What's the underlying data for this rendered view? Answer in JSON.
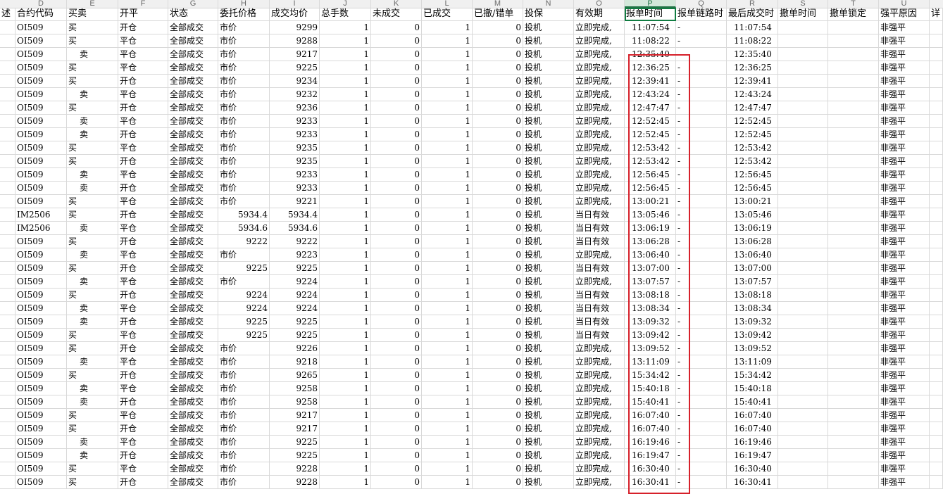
{
  "column_letters": [
    "D",
    "E",
    "F",
    "G",
    "H",
    "I",
    "J",
    "K",
    "L",
    "M",
    "N",
    "O",
    "P",
    "Q",
    "R",
    "S",
    "T",
    "U"
  ],
  "selected_column": "P",
  "header": {
    "a": "述",
    "d": "合约代码",
    "e": "买卖",
    "f": "开平",
    "g": "状态",
    "h": "委托价格",
    "i": "成交均价",
    "j": "总手数",
    "k": "未成交",
    "l": "已成交",
    "m": "已撤/错单",
    "n": "投保",
    "o": "有效期",
    "p": "报单时间",
    "q": "报单链路时",
    "r": "最后成交时",
    "s": "撤单时间",
    "t": "撤单锁定",
    "u": "强平原因",
    "v": "详"
  },
  "rows": [
    {
      "d": "OI509",
      "e": "买",
      "f": "开仓",
      "g": "全部成交",
      "h": "市价",
      "i": "9299",
      "j": "1",
      "k": "0",
      "l": "1",
      "m": "0",
      "n": "投机",
      "o": "立即完成,",
      "p": "11:07:54",
      "q": "-",
      "r": "11:07:54",
      "u": "非强平"
    },
    {
      "d": "OI509",
      "e": "买",
      "f": "平仓",
      "g": "全部成交",
      "h": "市价",
      "i": "9288",
      "j": "1",
      "k": "0",
      "l": "1",
      "m": "0",
      "n": "投机",
      "o": "立即完成,",
      "p": "11:08:22",
      "q": "-",
      "r": "11:08:22",
      "u": "非强平"
    },
    {
      "d": "OI509",
      "e": "卖",
      "f": "平仓",
      "g": "全部成交",
      "h": "市价",
      "i": "9217",
      "j": "1",
      "k": "0",
      "l": "1",
      "m": "0",
      "n": "投机",
      "o": "立即完成,",
      "p": "12:35:40",
      "q": "-",
      "r": "12:35:40",
      "u": "非强平"
    },
    {
      "d": "OI509",
      "e": "买",
      "f": "平仓",
      "g": "全部成交",
      "h": "市价",
      "i": "9225",
      "j": "1",
      "k": "0",
      "l": "1",
      "m": "0",
      "n": "投机",
      "o": "立即完成,",
      "p": "12:36:25",
      "q": "-",
      "r": "12:36:25",
      "u": "非强平"
    },
    {
      "d": "OI509",
      "e": "买",
      "f": "开仓",
      "g": "全部成交",
      "h": "市价",
      "i": "9234",
      "j": "1",
      "k": "0",
      "l": "1",
      "m": "0",
      "n": "投机",
      "o": "立即完成,",
      "p": "12:39:41",
      "q": "-",
      "r": "12:39:41",
      "u": "非强平"
    },
    {
      "d": "OI509",
      "e": "卖",
      "f": "平仓",
      "g": "全部成交",
      "h": "市价",
      "i": "9232",
      "j": "1",
      "k": "0",
      "l": "1",
      "m": "0",
      "n": "投机",
      "o": "立即完成,",
      "p": "12:43:24",
      "q": "-",
      "r": "12:43:24",
      "u": "非强平"
    },
    {
      "d": "OI509",
      "e": "买",
      "f": "开仓",
      "g": "全部成交",
      "h": "市价",
      "i": "9236",
      "j": "1",
      "k": "0",
      "l": "1",
      "m": "0",
      "n": "投机",
      "o": "立即完成,",
      "p": "12:47:47",
      "q": "-",
      "r": "12:47:47",
      "u": "非强平"
    },
    {
      "d": "OI509",
      "e": "卖",
      "f": "平仓",
      "g": "全部成交",
      "h": "市价",
      "i": "9233",
      "j": "1",
      "k": "0",
      "l": "1",
      "m": "0",
      "n": "投机",
      "o": "立即完成,",
      "p": "12:52:45",
      "q": "-",
      "r": "12:52:45",
      "u": "非强平"
    },
    {
      "d": "OI509",
      "e": "卖",
      "f": "开仓",
      "g": "全部成交",
      "h": "市价",
      "i": "9233",
      "j": "1",
      "k": "0",
      "l": "1",
      "m": "0",
      "n": "投机",
      "o": "立即完成,",
      "p": "12:52:45",
      "q": "-",
      "r": "12:52:45",
      "u": "非强平"
    },
    {
      "d": "OI509",
      "e": "买",
      "f": "平仓",
      "g": "全部成交",
      "h": "市价",
      "i": "9235",
      "j": "1",
      "k": "0",
      "l": "1",
      "m": "0",
      "n": "投机",
      "o": "立即完成,",
      "p": "12:53:42",
      "q": "-",
      "r": "12:53:42",
      "u": "非强平"
    },
    {
      "d": "OI509",
      "e": "买",
      "f": "开仓",
      "g": "全部成交",
      "h": "市价",
      "i": "9235",
      "j": "1",
      "k": "0",
      "l": "1",
      "m": "0",
      "n": "投机",
      "o": "立即完成,",
      "p": "12:53:42",
      "q": "-",
      "r": "12:53:42",
      "u": "非强平"
    },
    {
      "d": "OI509",
      "e": "卖",
      "f": "平仓",
      "g": "全部成交",
      "h": "市价",
      "i": "9233",
      "j": "1",
      "k": "0",
      "l": "1",
      "m": "0",
      "n": "投机",
      "o": "立即完成,",
      "p": "12:56:45",
      "q": "-",
      "r": "12:56:45",
      "u": "非强平"
    },
    {
      "d": "OI509",
      "e": "卖",
      "f": "开仓",
      "g": "全部成交",
      "h": "市价",
      "i": "9233",
      "j": "1",
      "k": "0",
      "l": "1",
      "m": "0",
      "n": "投机",
      "o": "立即完成,",
      "p": "12:56:45",
      "q": "-",
      "r": "12:56:45",
      "u": "非强平"
    },
    {
      "d": "OI509",
      "e": "买",
      "f": "平仓",
      "g": "全部成交",
      "h": "市价",
      "i": "9221",
      "j": "1",
      "k": "0",
      "l": "1",
      "m": "0",
      "n": "投机",
      "o": "立即完成,",
      "p": "13:00:21",
      "q": "-",
      "r": "13:00:21",
      "u": "非强平"
    },
    {
      "d": "IM2506",
      "e": "买",
      "f": "开仓",
      "g": "全部成交",
      "h": "5934.4",
      "i": "5934.4",
      "j": "1",
      "k": "0",
      "l": "1",
      "m": "0",
      "n": "投机",
      "o": "当日有效",
      "p": "13:05:46",
      "q": "-",
      "r": "13:05:46",
      "u": "非强平"
    },
    {
      "d": "IM2506",
      "e": "卖",
      "f": "平仓",
      "g": "全部成交",
      "h": "5934.6",
      "i": "5934.6",
      "j": "1",
      "k": "0",
      "l": "1",
      "m": "0",
      "n": "投机",
      "o": "当日有效",
      "p": "13:06:19",
      "q": "-",
      "r": "13:06:19",
      "u": "非强平"
    },
    {
      "d": "OI509",
      "e": "买",
      "f": "开仓",
      "g": "全部成交",
      "h": "9222",
      "i": "9222",
      "j": "1",
      "k": "0",
      "l": "1",
      "m": "0",
      "n": "投机",
      "o": "当日有效",
      "p": "13:06:28",
      "q": "-",
      "r": "13:06:28",
      "u": "非强平"
    },
    {
      "d": "OI509",
      "e": "卖",
      "f": "平仓",
      "g": "全部成交",
      "h": "市价",
      "i": "9223",
      "j": "1",
      "k": "0",
      "l": "1",
      "m": "0",
      "n": "投机",
      "o": "立即完成,",
      "p": "13:06:40",
      "q": "-",
      "r": "13:06:40",
      "u": "非强平"
    },
    {
      "d": "OI509",
      "e": "买",
      "f": "开仓",
      "g": "全部成交",
      "h": "9225",
      "i": "9225",
      "j": "1",
      "k": "0",
      "l": "1",
      "m": "0",
      "n": "投机",
      "o": "当日有效",
      "p": "13:07:00",
      "q": "-",
      "r": "13:07:00",
      "u": "非强平"
    },
    {
      "d": "OI509",
      "e": "卖",
      "f": "平仓",
      "g": "全部成交",
      "h": "市价",
      "i": "9224",
      "j": "1",
      "k": "0",
      "l": "1",
      "m": "0",
      "n": "投机",
      "o": "立即完成,",
      "p": "13:07:57",
      "q": "-",
      "r": "13:07:57",
      "u": "非强平"
    },
    {
      "d": "OI509",
      "e": "买",
      "f": "开仓",
      "g": "全部成交",
      "h": "9224",
      "i": "9224",
      "j": "1",
      "k": "0",
      "l": "1",
      "m": "0",
      "n": "投机",
      "o": "当日有效",
      "p": "13:08:18",
      "q": "-",
      "r": "13:08:18",
      "u": "非强平"
    },
    {
      "d": "OI509",
      "e": "卖",
      "f": "平仓",
      "g": "全部成交",
      "h": "9224",
      "i": "9224",
      "j": "1",
      "k": "0",
      "l": "1",
      "m": "0",
      "n": "投机",
      "o": "当日有效",
      "p": "13:08:34",
      "q": "-",
      "r": "13:08:34",
      "u": "非强平"
    },
    {
      "d": "OI509",
      "e": "卖",
      "f": "开仓",
      "g": "全部成交",
      "h": "9225",
      "i": "9225",
      "j": "1",
      "k": "0",
      "l": "1",
      "m": "0",
      "n": "投机",
      "o": "当日有效",
      "p": "13:09:32",
      "q": "-",
      "r": "13:09:32",
      "u": "非强平"
    },
    {
      "d": "OI509",
      "e": "买",
      "f": "平仓",
      "g": "全部成交",
      "h": "9225",
      "i": "9225",
      "j": "1",
      "k": "0",
      "l": "1",
      "m": "0",
      "n": "投机",
      "o": "当日有效",
      "p": "13:09:42",
      "q": "-",
      "r": "13:09:42",
      "u": "非强平"
    },
    {
      "d": "OI509",
      "e": "买",
      "f": "开仓",
      "g": "全部成交",
      "h": "市价",
      "i": "9226",
      "j": "1",
      "k": "0",
      "l": "1",
      "m": "0",
      "n": "投机",
      "o": "立即完成,",
      "p": "13:09:52",
      "q": "-",
      "r": "13:09:52",
      "u": "非强平"
    },
    {
      "d": "OI509",
      "e": "卖",
      "f": "平仓",
      "g": "全部成交",
      "h": "市价",
      "i": "9218",
      "j": "1",
      "k": "0",
      "l": "1",
      "m": "0",
      "n": "投机",
      "o": "立即完成,",
      "p": "13:11:09",
      "q": "-",
      "r": "13:11:09",
      "u": "非强平"
    },
    {
      "d": "OI509",
      "e": "买",
      "f": "开仓",
      "g": "全部成交",
      "h": "市价",
      "i": "9265",
      "j": "1",
      "k": "0",
      "l": "1",
      "m": "0",
      "n": "投机",
      "o": "立即完成,",
      "p": "15:34:42",
      "q": "-",
      "r": "15:34:42",
      "u": "非强平"
    },
    {
      "d": "OI509",
      "e": "卖",
      "f": "平仓",
      "g": "全部成交",
      "h": "市价",
      "i": "9258",
      "j": "1",
      "k": "0",
      "l": "1",
      "m": "0",
      "n": "投机",
      "o": "立即完成,",
      "p": "15:40:18",
      "q": "-",
      "r": "15:40:18",
      "u": "非强平"
    },
    {
      "d": "OI509",
      "e": "卖",
      "f": "开仓",
      "g": "全部成交",
      "h": "市价",
      "i": "9258",
      "j": "1",
      "k": "0",
      "l": "1",
      "m": "0",
      "n": "投机",
      "o": "立即完成,",
      "p": "15:40:41",
      "q": "-",
      "r": "15:40:41",
      "u": "非强平"
    },
    {
      "d": "OI509",
      "e": "买",
      "f": "平仓",
      "g": "全部成交",
      "h": "市价",
      "i": "9217",
      "j": "1",
      "k": "0",
      "l": "1",
      "m": "0",
      "n": "投机",
      "o": "立即完成,",
      "p": "16:07:40",
      "q": "-",
      "r": "16:07:40",
      "u": "非强平"
    },
    {
      "d": "OI509",
      "e": "买",
      "f": "开仓",
      "g": "全部成交",
      "h": "市价",
      "i": "9217",
      "j": "1",
      "k": "0",
      "l": "1",
      "m": "0",
      "n": "投机",
      "o": "立即完成,",
      "p": "16:07:40",
      "q": "-",
      "r": "16:07:40",
      "u": "非强平"
    },
    {
      "d": "OI509",
      "e": "卖",
      "f": "平仓",
      "g": "全部成交",
      "h": "市价",
      "i": "9225",
      "j": "1",
      "k": "0",
      "l": "1",
      "m": "0",
      "n": "投机",
      "o": "立即完成,",
      "p": "16:19:46",
      "q": "-",
      "r": "16:19:46",
      "u": "非强平"
    },
    {
      "d": "OI509",
      "e": "卖",
      "f": "开仓",
      "g": "全部成交",
      "h": "市价",
      "i": "9225",
      "j": "1",
      "k": "0",
      "l": "1",
      "m": "0",
      "n": "投机",
      "o": "立即完成,",
      "p": "16:19:47",
      "q": "-",
      "r": "16:19:47",
      "u": "非强平"
    },
    {
      "d": "OI509",
      "e": "买",
      "f": "平仓",
      "g": "全部成交",
      "h": "市价",
      "i": "9228",
      "j": "1",
      "k": "0",
      "l": "1",
      "m": "0",
      "n": "投机",
      "o": "立即完成,",
      "p": "16:30:40",
      "q": "-",
      "r": "16:30:40",
      "u": "非强平"
    },
    {
      "d": "OI509",
      "e": "买",
      "f": "开仓",
      "g": "全部成交",
      "h": "市价",
      "i": "9228",
      "j": "1",
      "k": "0",
      "l": "1",
      "m": "0",
      "n": "投机",
      "o": "立即完成,",
      "p": "16:30:41",
      "q": "-",
      "r": "16:30:41",
      "u": "非强平"
    }
  ],
  "highlight_color": "#d6202a",
  "selection_color": "#107c41"
}
